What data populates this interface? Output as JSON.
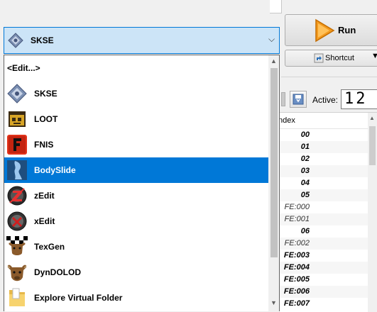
{
  "run_button": {
    "label": "Run"
  },
  "shortcut_button": {
    "label": "Shortcut"
  },
  "active": {
    "label": "Active:",
    "value": "12"
  },
  "mod_list": {
    "header": "ndex",
    "rows": [
      {
        "value": "00",
        "style": "bold"
      },
      {
        "value": "01",
        "style": "bold"
      },
      {
        "value": "02",
        "style": "bold"
      },
      {
        "value": "03",
        "style": "bold"
      },
      {
        "value": "04",
        "style": "bold"
      },
      {
        "value": "05",
        "style": "bold"
      },
      {
        "value": "FE:000",
        "style": "light"
      },
      {
        "value": "FE:001",
        "style": "light"
      },
      {
        "value": "06",
        "style": "bold"
      },
      {
        "value": "FE:002",
        "style": "light"
      },
      {
        "value": "FE:003",
        "style": "bold"
      },
      {
        "value": "FE:004",
        "style": "bold"
      },
      {
        "value": "FE:005",
        "style": "bold"
      },
      {
        "value": "FE:006",
        "style": "bold"
      },
      {
        "value": "FE:007",
        "style": "bold"
      }
    ]
  },
  "executable_combo": {
    "selected": "SKSE",
    "selected_icon": "skse-icon",
    "items": [
      {
        "label": "<Edit...>",
        "icon": ""
      },
      {
        "label": "SKSE",
        "icon": "skse-icon"
      },
      {
        "label": "LOOT",
        "icon": "loot-icon"
      },
      {
        "label": "FNIS",
        "icon": "fnis-icon"
      },
      {
        "label": "BodySlide",
        "icon": "bodyslide-icon",
        "highlighted": true
      },
      {
        "label": "zEdit",
        "icon": "zedit-icon"
      },
      {
        "label": "xEdit",
        "icon": "xedit-icon"
      },
      {
        "label": "TexGen",
        "icon": "texgen-icon"
      },
      {
        "label": "DynDOLOD",
        "icon": "dyndolod-icon"
      },
      {
        "label": "Explore Virtual Folder",
        "icon": "folder-icon"
      }
    ]
  },
  "colors": {
    "highlight": "#0078d7",
    "combo_bg": "#cce4f7"
  }
}
